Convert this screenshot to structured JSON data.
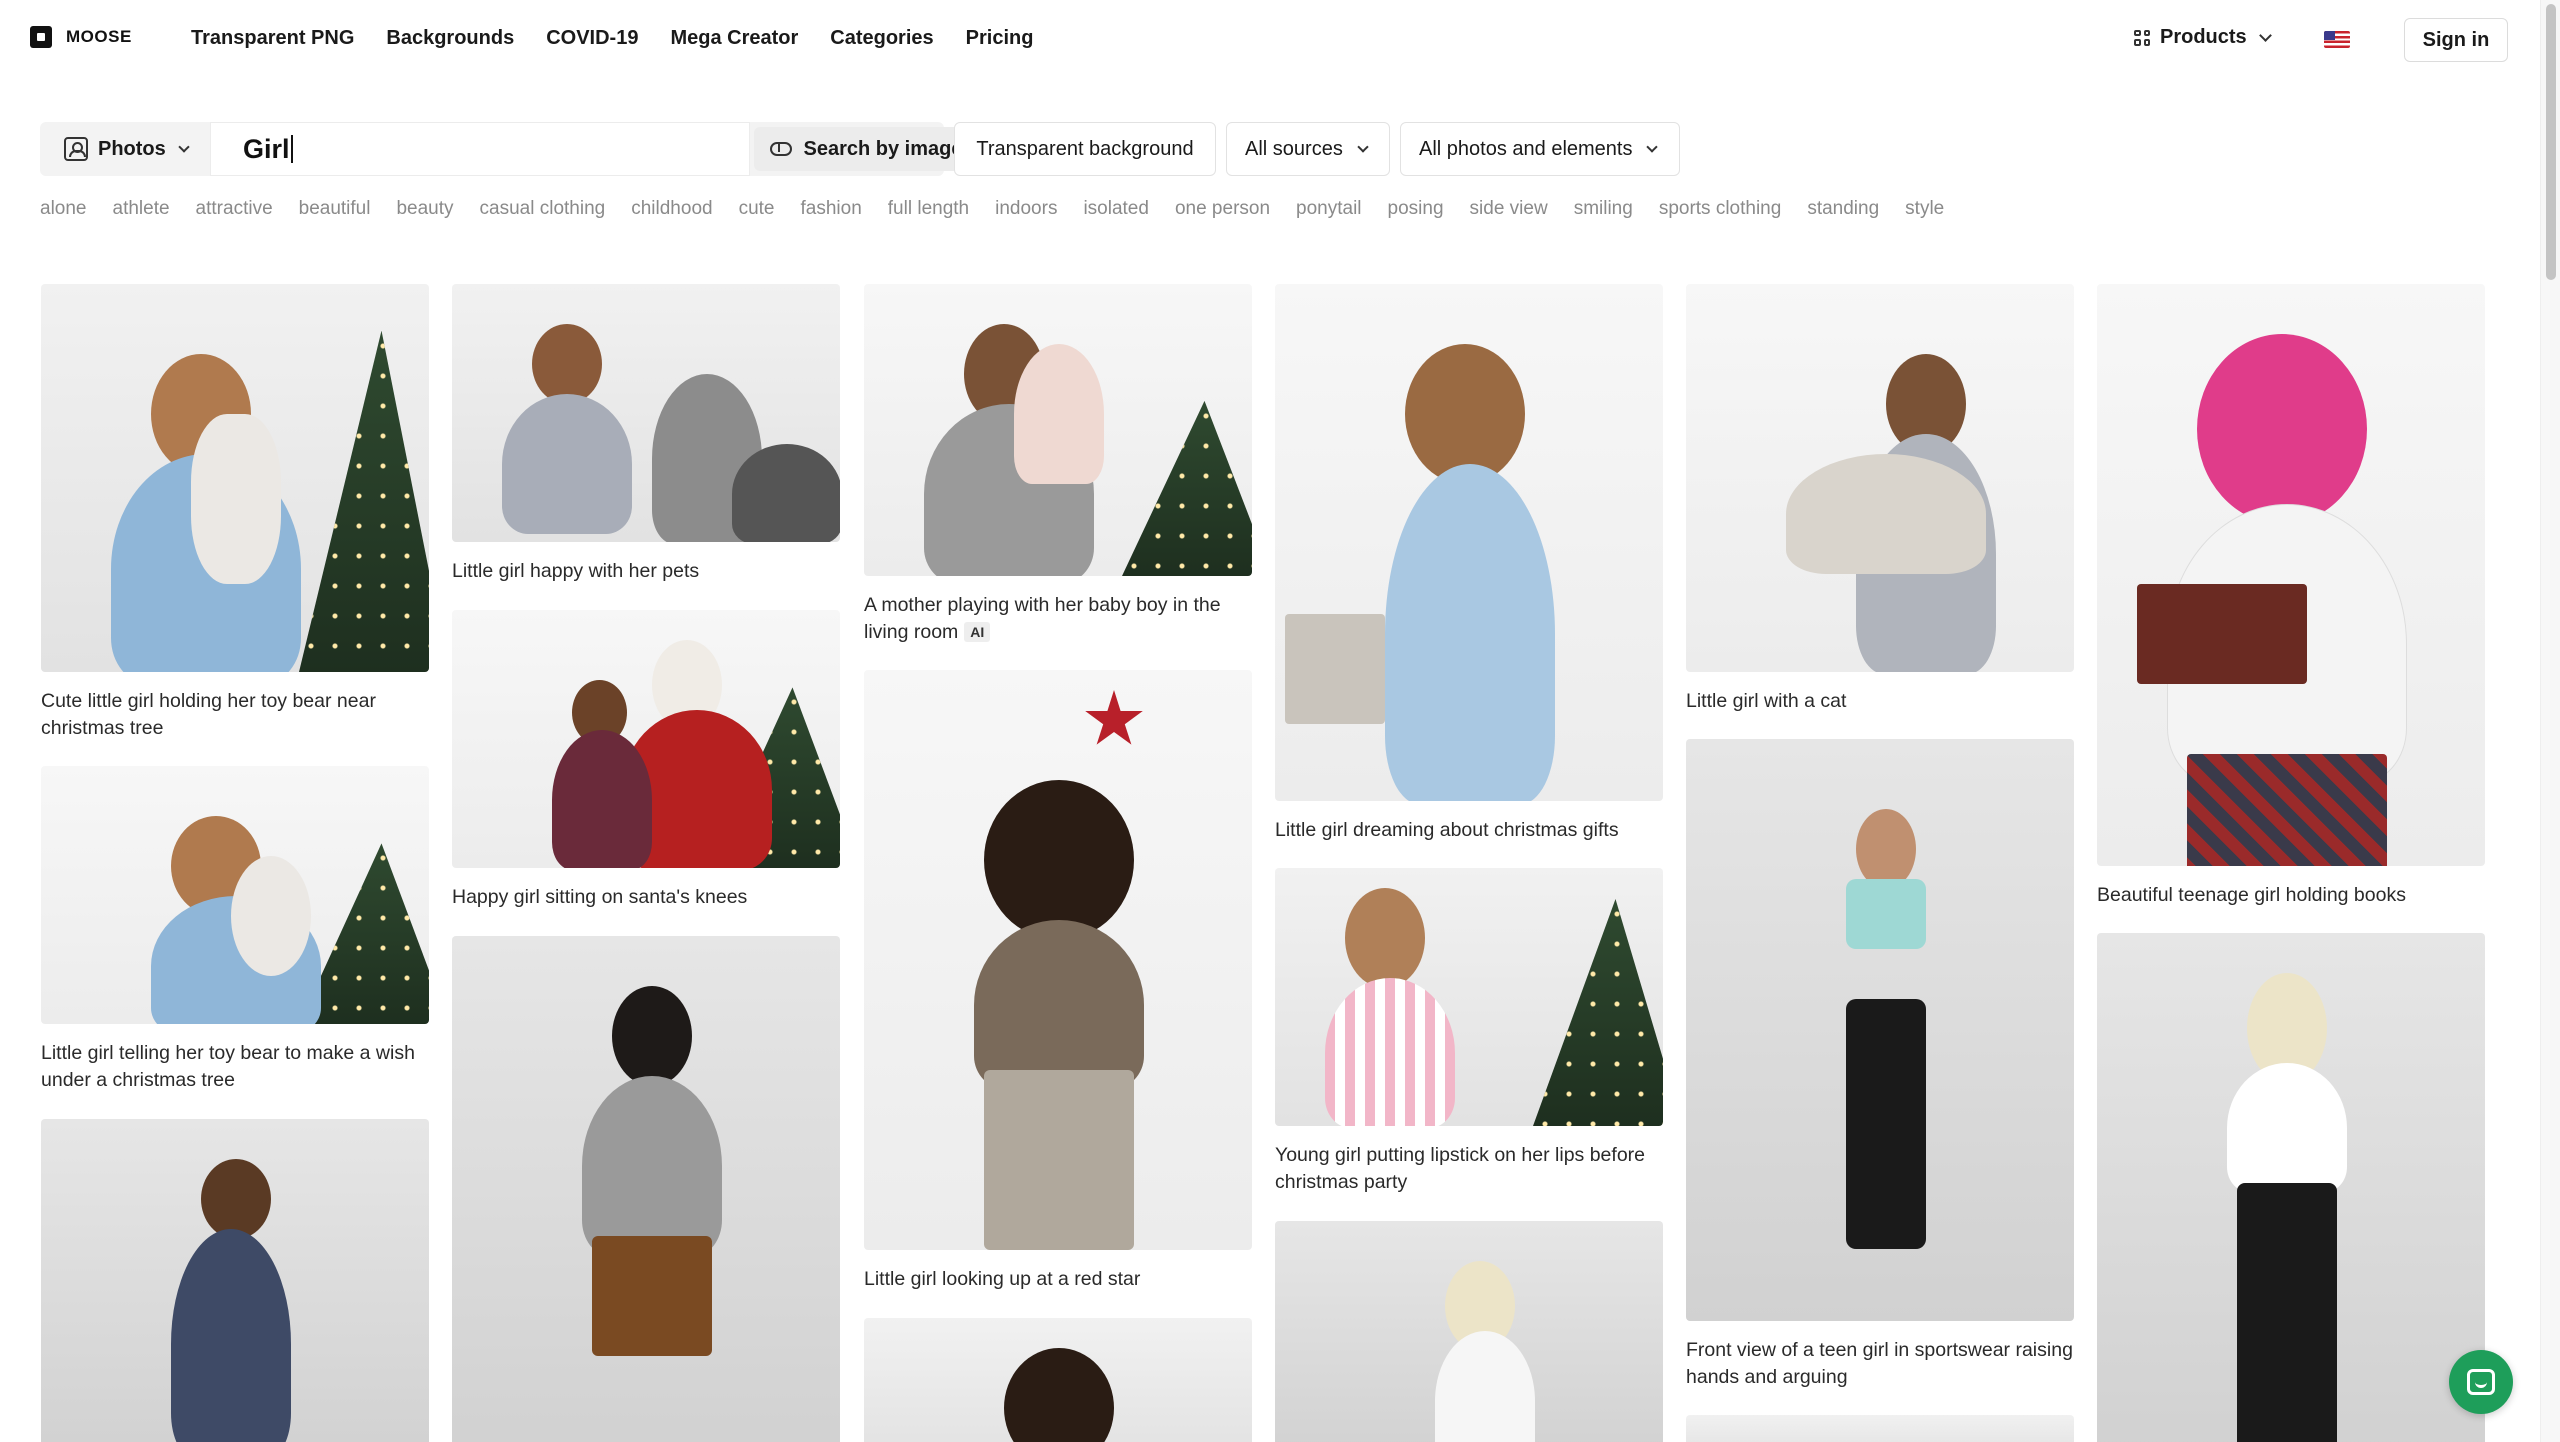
{
  "brand": {
    "name": "MOOSE"
  },
  "nav": {
    "links": [
      "Transparent PNG",
      "Backgrounds",
      "COVID-19",
      "Mega Creator",
      "Categories",
      "Pricing"
    ],
    "products_label": "Products",
    "signin_label": "Sign in"
  },
  "search": {
    "type_label": "Photos",
    "query": "Girl",
    "search_by_image_label": "Search by image",
    "filters": {
      "transparent": "Transparent background",
      "sources": "All sources",
      "elements": "All photos and elements"
    }
  },
  "tags": [
    "alone",
    "athlete",
    "attractive",
    "beautiful",
    "beauty",
    "casual clothing",
    "childhood",
    "cute",
    "fashion",
    "full length",
    "indoors",
    "isolated",
    "one person",
    "ponytail",
    "posing",
    "side view",
    "smiling",
    "sports clothing",
    "standing",
    "style"
  ],
  "results": {
    "col1": [
      {
        "caption": "Cute little girl holding her toy bear near christmas tree"
      },
      {
        "caption": "Little girl telling her toy bear to make a wish under a christmas tree"
      },
      {
        "caption": ""
      }
    ],
    "col2": [
      {
        "caption": "Little girl happy with her pets"
      },
      {
        "caption": "Happy girl sitting on santa's knees"
      },
      {
        "caption": ""
      }
    ],
    "col3": [
      {
        "caption": "A mother playing with her baby boy in the living room",
        "badge": "AI"
      },
      {
        "caption": "Little girl looking up at a red star"
      },
      {
        "caption": ""
      }
    ],
    "col4": [
      {
        "caption": "Little girl dreaming about christmas gifts"
      },
      {
        "caption": "Young girl putting lipstick on her lips before christmas party"
      },
      {
        "caption": ""
      }
    ],
    "col5": [
      {
        "caption": "Little girl with a cat"
      },
      {
        "caption": "Front view of a teen girl in sportswear raising hands and arguing"
      },
      {
        "caption": ""
      }
    ],
    "col6": [
      {
        "caption": "Beautiful teenage girl holding books"
      },
      {
        "caption": ""
      }
    ]
  },
  "colors": {
    "accent_chat": "#1e9e5a",
    "tag_grey": "#8a8a8a"
  }
}
